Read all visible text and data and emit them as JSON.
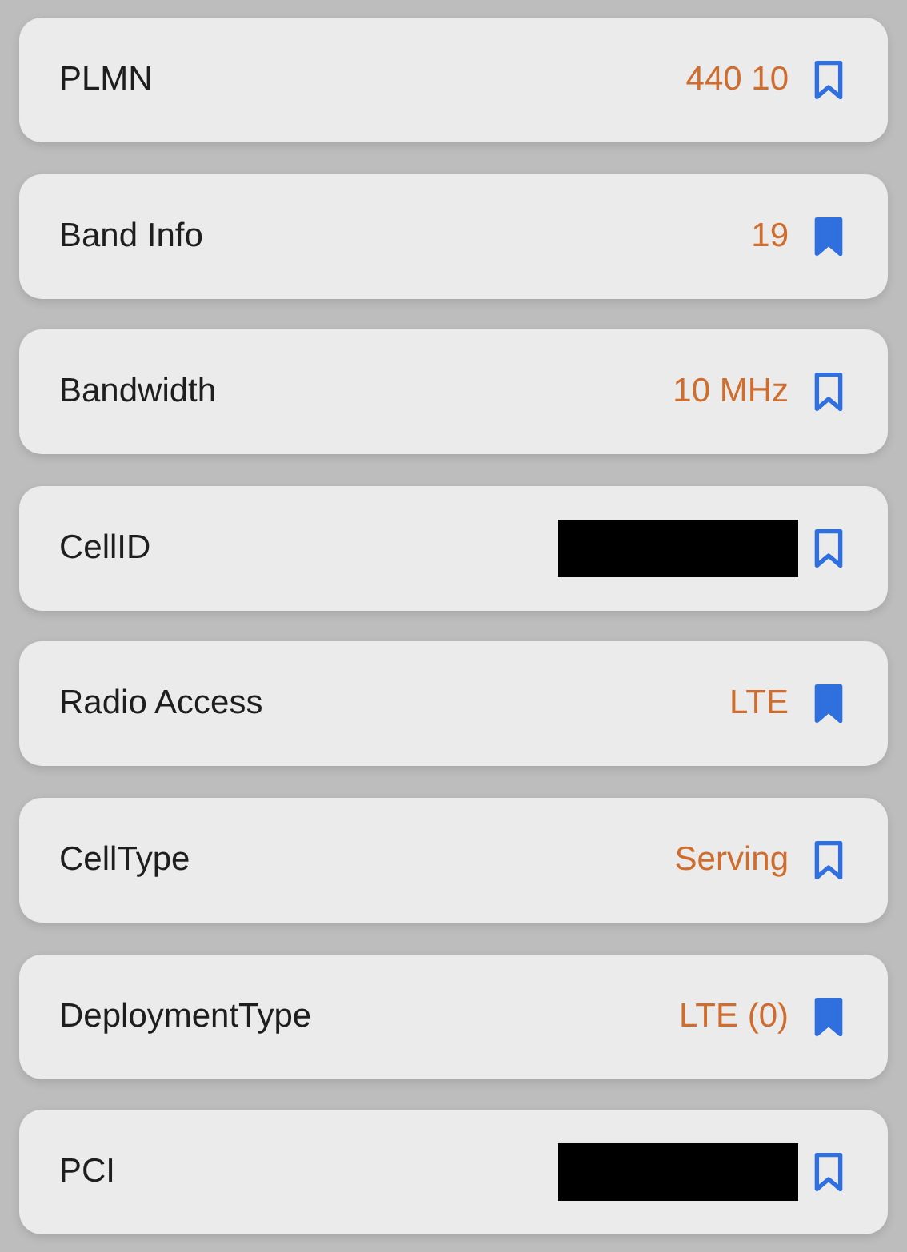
{
  "rows": [
    {
      "label": "PLMN",
      "value": "440 10",
      "redacted": false,
      "bookmarked": false
    },
    {
      "label": "Band Info",
      "value": "19",
      "redacted": false,
      "bookmarked": true
    },
    {
      "label": "Bandwidth",
      "value": "10 MHz",
      "redacted": false,
      "bookmarked": false
    },
    {
      "label": "CellID",
      "redacted": true,
      "bookmarked": false
    },
    {
      "label": "Radio Access",
      "value": "LTE",
      "redacted": false,
      "bookmarked": true
    },
    {
      "label": "CellType",
      "value": "Serving",
      "redacted": false,
      "bookmarked": false
    },
    {
      "label": "DeploymentType",
      "value": "LTE (0)",
      "redacted": false,
      "bookmarked": true
    },
    {
      "label": "PCI",
      "redacted": true,
      "bookmarked": false
    }
  ]
}
